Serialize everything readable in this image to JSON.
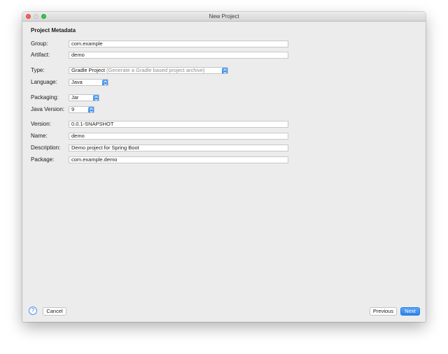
{
  "window": {
    "title": "New Project"
  },
  "form": {
    "section_title": "Project Metadata",
    "group": {
      "label": "Group:",
      "value": "com.example"
    },
    "artifact": {
      "label": "Artifact:",
      "value": "demo"
    },
    "type": {
      "label": "Type:",
      "value": "Gradle Project",
      "hint": "(Generate a Gradle based project archive)"
    },
    "language": {
      "label": "Language:",
      "value": "Java"
    },
    "packaging": {
      "label": "Packaging:",
      "value": "Jar"
    },
    "java_version": {
      "label": "Java Version:",
      "value": "9"
    },
    "version": {
      "label": "Version:",
      "value": "0.0.1-SNAPSHOT"
    },
    "name": {
      "label": "Name:",
      "value": "demo"
    },
    "description": {
      "label": "Description:",
      "value": "Demo project for Spring Boot"
    },
    "package": {
      "label": "Package:",
      "value": "com.example.demo"
    }
  },
  "footer": {
    "help_glyph": "?",
    "cancel_label": "Cancel",
    "previous_label": "Previous",
    "next_label": "Next"
  },
  "icons": {
    "help": "question-mark-icon",
    "stepper": "up-down-chevron-icon"
  },
  "colors": {
    "accent": "#2b82ef",
    "close": "#fd5f57",
    "maximize": "#35c84a"
  }
}
